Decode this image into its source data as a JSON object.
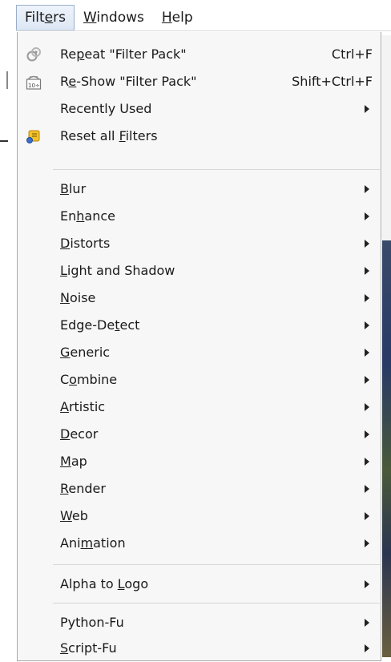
{
  "menubar": {
    "items": [
      {
        "pre": "Filt",
        "ul": "e",
        "post": "rs"
      },
      {
        "pre": "",
        "ul": "W",
        "post": "indows"
      },
      {
        "pre": "",
        "ul": "H",
        "post": "elp"
      }
    ]
  },
  "menu": {
    "repeat": {
      "pre": "Re",
      "ul": "p",
      "post": "eat \"Filter Pack\"",
      "shortcut": "Ctrl+F",
      "icon": "repeat-filter-icon"
    },
    "reshow": {
      "pre": "R",
      "ul": "e",
      "post": "-Show \"Filter Pack\"",
      "shortcut": "Shift+Ctrl+F",
      "icon": "reshow-filter-icon"
    },
    "recently_used": {
      "pre": "Recently Used",
      "ul": "",
      "post": ""
    },
    "reset": {
      "pre": "Reset all ",
      "ul": "F",
      "post": "ilters",
      "icon": "reset-filters-icon"
    },
    "categories": [
      {
        "pre": "",
        "ul": "B",
        "post": "lur"
      },
      {
        "pre": "En",
        "ul": "h",
        "post": "ance"
      },
      {
        "pre": "",
        "ul": "D",
        "post": "istorts"
      },
      {
        "pre": "",
        "ul": "L",
        "post": "ight and Shadow"
      },
      {
        "pre": "",
        "ul": "N",
        "post": "oise"
      },
      {
        "pre": "Edge-De",
        "ul": "t",
        "post": "ect"
      },
      {
        "pre": "",
        "ul": "G",
        "post": "eneric"
      },
      {
        "pre": "C",
        "ul": "o",
        "post": "mbine"
      },
      {
        "pre": "",
        "ul": "A",
        "post": "rtistic"
      },
      {
        "pre": "",
        "ul": "D",
        "post": "ecor"
      },
      {
        "pre": "",
        "ul": "M",
        "post": "ap"
      },
      {
        "pre": "",
        "ul": "R",
        "post": "ender"
      },
      {
        "pre": "",
        "ul": "W",
        "post": "eb"
      },
      {
        "pre": "Ani",
        "ul": "m",
        "post": "ation"
      }
    ],
    "alpha_to_logo": {
      "pre": "Alpha to ",
      "ul": "L",
      "post": "ogo"
    },
    "python_fu": {
      "pre": "Python-Fu",
      "ul": "",
      "post": ""
    },
    "script_fu": {
      "pre": "",
      "ul": "S",
      "post": "cript-Fu"
    }
  }
}
